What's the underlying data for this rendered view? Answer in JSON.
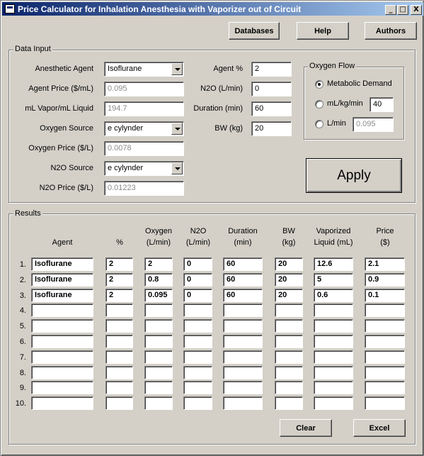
{
  "window": {
    "title": "Price Calculator for Inhalation Anesthesia with Vaporizer out of Circuit",
    "minimize": "_",
    "maximize": "□",
    "close": "X"
  },
  "toolbar": {
    "databases": "Databases",
    "help": "Help",
    "authors": "Authors"
  },
  "data_input": {
    "legend": "Data Input",
    "anesthetic_agent_label": "Anesthetic Agent",
    "anesthetic_agent": "Isoflurane",
    "agent_price_label": "Agent Price ($/mL)",
    "agent_price": "0.095",
    "vapor_label": "mL Vapor/mL Liquid",
    "vapor": "194.7",
    "oxygen_source_label": "Oxygen Source",
    "oxygen_source": "e cylynder",
    "oxygen_price_label": "Oxygen Price ($/L)",
    "oxygen_price": "0.0078",
    "n2o_source_label": "N2O Source",
    "n2o_source": "e cylynder",
    "n2o_price_label": "N2O Price ($/L)",
    "n2o_price": "0.01223",
    "agent_pct_label": "Agent %",
    "agent_pct": "2",
    "n2o_flow_label": "N2O (L/min)",
    "n2o_flow": "0",
    "duration_label": "Duration (min)",
    "duration": "60",
    "bw_label": "BW (kg)",
    "bw": "20"
  },
  "oxygen_flow": {
    "legend": "Oxygen Flow",
    "metabolic_label": "Metabolic Demand",
    "ml_kg_min_label": "mL/kg/min",
    "ml_kg_min_value": "40",
    "l_min_label": "L/min",
    "l_min_value": "0.095",
    "selected": "Metabolic Demand"
  },
  "apply_label": "Apply",
  "results": {
    "legend": "Results",
    "headers": {
      "agent": "Agent",
      "pct": "%",
      "oxygen": [
        "Oxygen",
        "(L/min)"
      ],
      "n2o": [
        "N2O",
        "(L/min)"
      ],
      "duration": [
        "Duration",
        "(min)"
      ],
      "bw": [
        "BW",
        "(kg)"
      ],
      "vaporized": [
        "Vaporized",
        "Liquid (mL)"
      ],
      "price": [
        "Price",
        "($)"
      ]
    },
    "rows": [
      {
        "num": "1.",
        "agent": "Isoflurane",
        "pct": "2",
        "oxygen": "2",
        "n2o": "0",
        "duration": "60",
        "bw": "20",
        "vaporized": "12.6",
        "price": "2.1"
      },
      {
        "num": "2.",
        "agent": "Isoflurane",
        "pct": "2",
        "oxygen": "0.8",
        "n2o": "0",
        "duration": "60",
        "bw": "20",
        "vaporized": "5",
        "price": "0.9"
      },
      {
        "num": "3.",
        "agent": "Isoflurane",
        "pct": "2",
        "oxygen": "0.095",
        "n2o": "0",
        "duration": "60",
        "bw": "20",
        "vaporized": "0.6",
        "price": "0.1"
      },
      {
        "num": "4.",
        "agent": "",
        "pct": "",
        "oxygen": "",
        "n2o": "",
        "duration": "",
        "bw": "",
        "vaporized": "",
        "price": ""
      },
      {
        "num": "5.",
        "agent": "",
        "pct": "",
        "oxygen": "",
        "n2o": "",
        "duration": "",
        "bw": "",
        "vaporized": "",
        "price": ""
      },
      {
        "num": "6.",
        "agent": "",
        "pct": "",
        "oxygen": "",
        "n2o": "",
        "duration": "",
        "bw": "",
        "vaporized": "",
        "price": ""
      },
      {
        "num": "7.",
        "agent": "",
        "pct": "",
        "oxygen": "",
        "n2o": "",
        "duration": "",
        "bw": "",
        "vaporized": "",
        "price": ""
      },
      {
        "num": "8.",
        "agent": "",
        "pct": "",
        "oxygen": "",
        "n2o": "",
        "duration": "",
        "bw": "",
        "vaporized": "",
        "price": ""
      },
      {
        "num": "9.",
        "agent": "",
        "pct": "",
        "oxygen": "",
        "n2o": "",
        "duration": "",
        "bw": "",
        "vaporized": "",
        "price": ""
      },
      {
        "num": "10.",
        "agent": "",
        "pct": "",
        "oxygen": "",
        "n2o": "",
        "duration": "",
        "bw": "",
        "vaporized": "",
        "price": ""
      }
    ]
  },
  "footer": {
    "clear": "Clear",
    "excel": "Excel"
  }
}
